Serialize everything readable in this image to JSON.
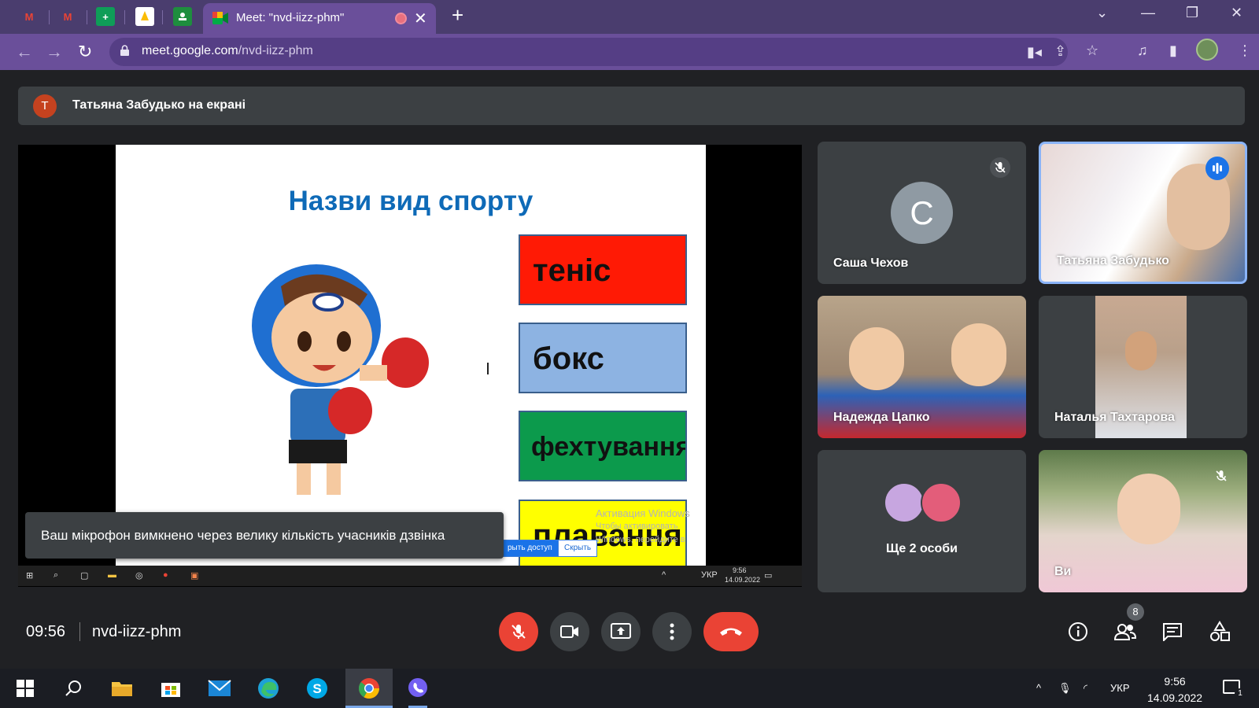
{
  "browser": {
    "tabs": [
      {
        "icon": "gmail-icon"
      },
      {
        "icon": "gmail-icon"
      },
      {
        "icon": "sheets-icon"
      },
      {
        "icon": "keep-icon"
      },
      {
        "icon": "classroom-icon"
      }
    ],
    "active_tab_title": "Meet: \"nvd-iizz-phm\"",
    "url_host": "meet.google.com",
    "url_path": "/nvd-iizz-phm"
  },
  "presenting_banner": {
    "avatar_letter": "T",
    "text": "Татьяна Забудько на екрані"
  },
  "slide": {
    "title": "Назви вид спорту",
    "words": [
      {
        "text": "теніс",
        "color": "#ff1a05"
      },
      {
        "text": "бокс",
        "color": "#8db3e2"
      },
      {
        "text": "фехтування",
        "color": "#0c9a4c"
      },
      {
        "text": "плавання",
        "color": "#ffff00"
      }
    ],
    "watermark_line1": "Активация Windows",
    "watermark_line2": "Чтобы активировать Windows, перейдите в",
    "popup_share": "рыть доступ",
    "popup_hide": "Скрыть",
    "tray_lang": "УКР",
    "tray_time": "9:56",
    "tray_date": "14.09.2022"
  },
  "toast": "Ваш мікрофон вимкнено через велику кількість учасників дзвінка",
  "participants": [
    {
      "name": "Саша Чехов",
      "avatar_letter": "C",
      "muted": true
    },
    {
      "name": "Татьяна Забудько",
      "speaking": true
    },
    {
      "name": "Надежда Цапко"
    },
    {
      "name": "Наталья Тахтарова"
    },
    {
      "name": "Ще 2 особи"
    },
    {
      "name": "Ви",
      "muted": true
    }
  ],
  "controls": {
    "time": "09:56",
    "meeting_code": "nvd-iizz-phm",
    "people_count": "8"
  },
  "taskbar": {
    "lang": "УКР",
    "time": "9:56",
    "date": "14.09.2022",
    "notification_count": "1"
  },
  "colors": {
    "tabstrip": "#4a3d6e",
    "toolbar": "#6a4f9a",
    "meet_bg": "#202124",
    "tile_bg": "#3c4043",
    "end_call_red": "#ea4335",
    "speaking_blue": "#1a73e8"
  }
}
